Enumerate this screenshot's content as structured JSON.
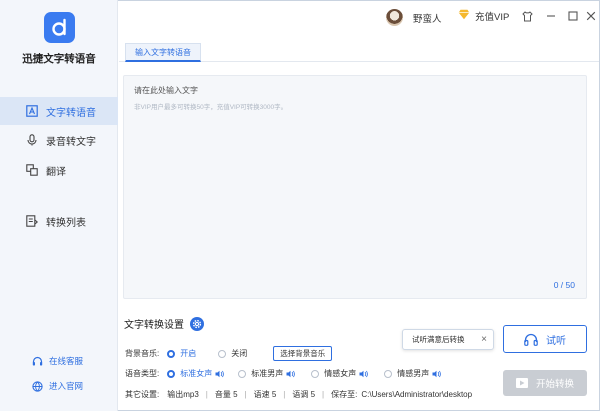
{
  "app": {
    "name": "迅捷文字转语音"
  },
  "sidebar": {
    "items": [
      {
        "label": "文字转语音",
        "icon": "text-icon",
        "active": true
      },
      {
        "label": "录音转文字",
        "icon": "microphone-icon",
        "active": false
      },
      {
        "label": "翻译",
        "icon": "translate-icon",
        "active": false
      },
      {
        "label": "转换列表",
        "icon": "list-icon",
        "active": false
      }
    ],
    "footer": [
      {
        "label": "在线客服",
        "icon": "headset-icon"
      },
      {
        "label": "进入官网",
        "icon": "globe-icon"
      }
    ]
  },
  "titlebar": {
    "username": "野蛮人",
    "vip_label": "充值VIP"
  },
  "tabs": [
    {
      "label": "输入文字转语音",
      "active": true
    }
  ],
  "editor": {
    "placeholder": "请在此处输入文字",
    "hint": "非VIP用户最多可转换50字，充值VIP可转换3000字。",
    "count": "0 / 50"
  },
  "settings": {
    "title": "文字转换设置",
    "bgm": {
      "label": "背景音乐:",
      "options": [
        "开启",
        "关闭"
      ],
      "selected": "开启",
      "button": "选择背景音乐"
    },
    "voice": {
      "label": "语音类型:",
      "options": [
        "标准女声",
        "标准男声",
        "情感女声",
        "情感男声"
      ],
      "selected": "标准女声"
    },
    "other": {
      "label": "其它设置:",
      "format": "输出mp3",
      "volume": "音量 5",
      "speed": "语速 5",
      "tone": "语调 5",
      "save_label": "保存至:",
      "save_path": "C:\\Users\\Administrator\\desktop"
    }
  },
  "actions": {
    "tooltip": "试听满意后转换",
    "listen": "试听",
    "convert": "开始转换"
  },
  "colors": {
    "accent": "#2f6fe0",
    "sidebar_bg": "#f3f6fb",
    "disabled": "#c9cdd3"
  }
}
